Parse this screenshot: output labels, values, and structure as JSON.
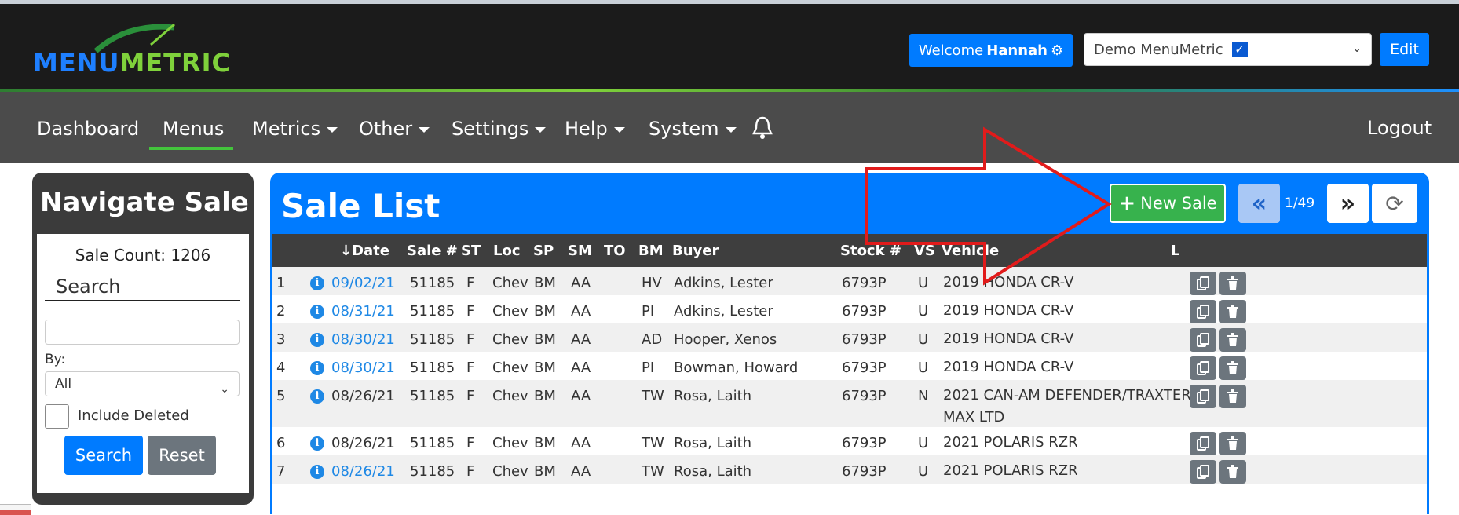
{
  "header": {
    "logo": {
      "part1": "MENU",
      "part2": "METRIC"
    },
    "welcome_prefix": "Welcome",
    "welcome_name": "Hannah",
    "dealer_select": "Demo MenuMetric",
    "edit_label": "Edit"
  },
  "nav": {
    "items": [
      "Dashboard",
      "Menus",
      "Metrics",
      "Other",
      "Settings",
      "Help",
      "System"
    ],
    "logout": "Logout"
  },
  "sidebar": {
    "title": "Navigate Sale",
    "sale_count": "Sale Count: 1206",
    "search_heading": "Search",
    "by_label": "By:",
    "by_value": "All",
    "include_deleted": "Include Deleted",
    "search_btn": "Search",
    "reset_btn": "Reset"
  },
  "main": {
    "title": "Sale List",
    "new_sale": "New Sale",
    "prev": "«",
    "page": "1/49",
    "next": "»",
    "columns": [
      "↓Date",
      "Sale #",
      "ST",
      "Loc",
      "SP",
      "SM",
      "TO",
      "BM",
      "Buyer",
      "Stock #",
      "VS",
      "Vehicle",
      "L"
    ],
    "rows": [
      {
        "n": "1",
        "date": "09/02/21",
        "date_link": true,
        "sale": "51185",
        "st": "F",
        "loc": "Chev",
        "sp": "BM",
        "sm": "AA",
        "to": "",
        "bm": "HV",
        "buyer": "Adkins, Lester",
        "stock": "6793P",
        "vs": "U",
        "vehicle": "2019 HONDA CR-V"
      },
      {
        "n": "2",
        "date": "08/31/21",
        "date_link": true,
        "sale": "51185",
        "st": "F",
        "loc": "Chev",
        "sp": "BM",
        "sm": "AA",
        "to": "",
        "bm": "PI",
        "buyer": "Adkins, Lester",
        "stock": "6793P",
        "vs": "U",
        "vehicle": "2019 HONDA CR-V"
      },
      {
        "n": "3",
        "date": "08/30/21",
        "date_link": true,
        "sale": "51185",
        "st": "F",
        "loc": "Chev",
        "sp": "BM",
        "sm": "AA",
        "to": "",
        "bm": "AD",
        "buyer": "Hooper, Xenos",
        "stock": "6793P",
        "vs": "U",
        "vehicle": "2019 HONDA CR-V"
      },
      {
        "n": "4",
        "date": "08/30/21",
        "date_link": true,
        "sale": "51185",
        "st": "F",
        "loc": "Chev",
        "sp": "BM",
        "sm": "AA",
        "to": "",
        "bm": "PI",
        "buyer": "Bowman, Howard",
        "stock": "6793P",
        "vs": "U",
        "vehicle": "2019 HONDA CR-V"
      },
      {
        "n": "5",
        "date": "08/26/21",
        "date_link": false,
        "sale": "51185",
        "st": "F",
        "loc": "Chev",
        "sp": "BM",
        "sm": "AA",
        "to": "",
        "bm": "TW",
        "buyer": "Rosa, Laith",
        "stock": "6793P",
        "vs": "N",
        "vehicle": "2021 CAN-AM DEFENDER/TRAXTER - MAX LTD"
      },
      {
        "n": "6",
        "date": "08/26/21",
        "date_link": false,
        "sale": "51185",
        "st": "F",
        "loc": "Chev",
        "sp": "BM",
        "sm": "AA",
        "to": "",
        "bm": "TW",
        "buyer": "Rosa, Laith",
        "stock": "6793P",
        "vs": "U",
        "vehicle": "2021 POLARIS RZR"
      },
      {
        "n": "7",
        "date": "08/26/21",
        "date_link": true,
        "sale": "51185",
        "st": "F",
        "loc": "Chev",
        "sp": "BM",
        "sm": "AA",
        "to": "",
        "bm": "TW",
        "buyer": "Rosa, Laith",
        "stock": "6793P",
        "vs": "U",
        "vehicle": "2021 POLARIS RZR"
      }
    ]
  },
  "colors": {
    "primary": "#007bff",
    "success": "#37b24d",
    "header": "#1b1b1b",
    "nav": "#4b4b4b",
    "annotation": "#e11b1b"
  }
}
